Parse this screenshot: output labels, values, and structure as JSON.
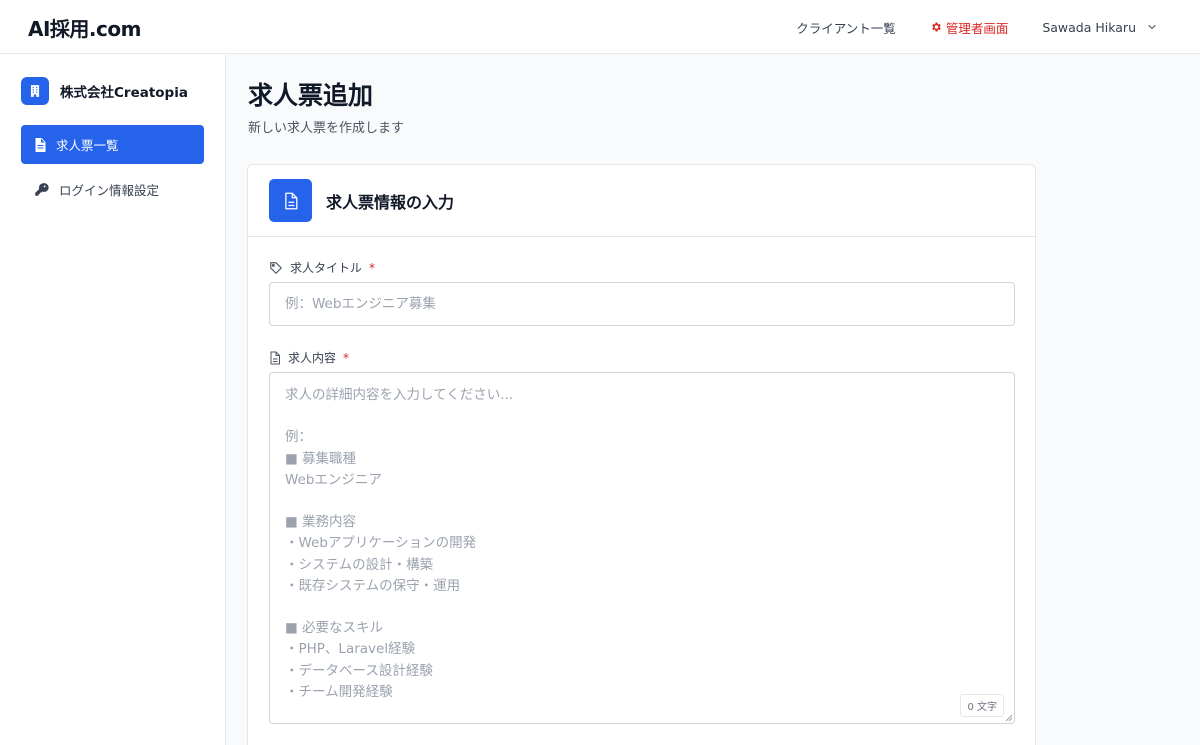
{
  "header": {
    "logo": "AI採用.com",
    "nav": {
      "clients": "クライアント一覧",
      "admin": "管理者画面",
      "user": "Sawada Hikaru"
    }
  },
  "sidebar": {
    "company": "株式会社Creatopia",
    "items": [
      {
        "label": "求人票一覧",
        "icon": "document-icon",
        "active": true
      },
      {
        "label": "ログイン情報設定",
        "icon": "key-icon",
        "active": false
      }
    ]
  },
  "main": {
    "title": "求人票追加",
    "subtitle": "新しい求人票を作成します",
    "card": {
      "title": "求人票情報の入力",
      "fields": {
        "job_title": {
          "label": "求人タイトル",
          "required_mark": "*",
          "value": "",
          "placeholder": "例：Webエンジニア募集"
        },
        "job_body": {
          "label": "求人内容",
          "required_mark": "*",
          "value": "",
          "placeholder": "求人の詳細内容を入力してください...\n\n例：\n■ 募集職種\nWebエンジニア\n\n■ 業務内容\n・Webアプリケーションの開発\n・システムの設計・構築\n・既存システムの保守・運用\n\n■ 必要なスキル\n・PHP、Laravel経験\n・データベース設計経験\n・チーム開発経験",
          "counter": "0 文字"
        }
      }
    }
  },
  "colors": {
    "accent": "#2563eb",
    "admin": "#dc2626",
    "required": "#dc2626"
  }
}
